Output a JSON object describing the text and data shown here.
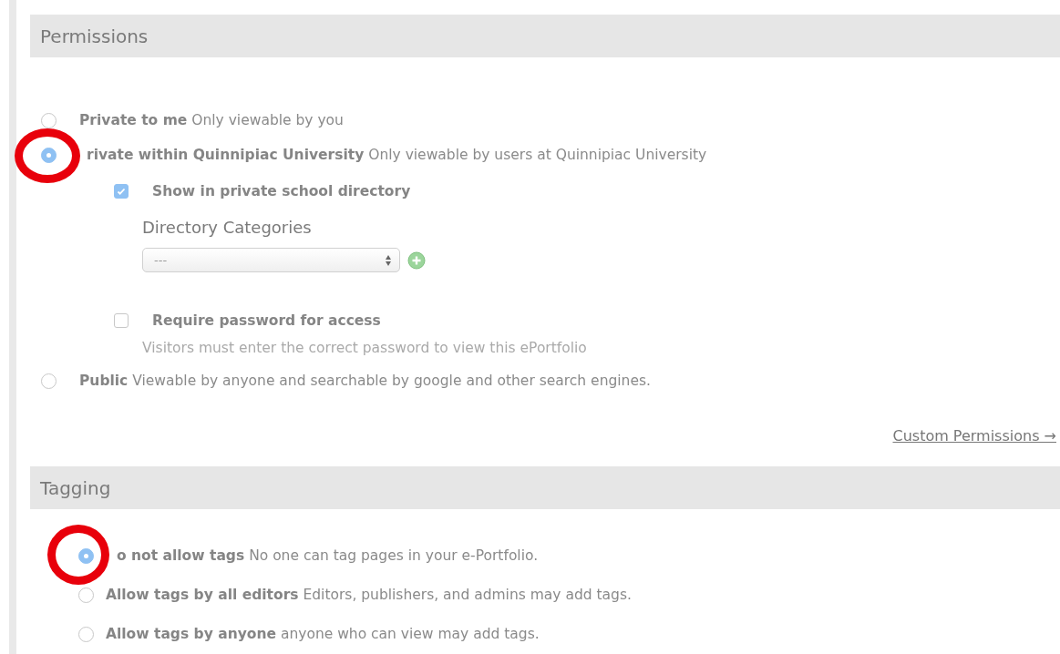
{
  "permissions": {
    "title": "Permissions",
    "options": [
      {
        "label": "Private to me",
        "description": "Only viewable by you",
        "selected": false,
        "circled": false
      },
      {
        "label": "rivate within Quinnipiac University",
        "description": "Only viewable by users at Quinnipiac University",
        "selected": true,
        "circled": true,
        "details": {
          "show_directory": {
            "label": "Show in private school directory",
            "checked": true
          },
          "categories": {
            "label": "Directory Categories",
            "value": "---"
          },
          "require_password": {
            "label": "Require password for access",
            "checked": false,
            "note": "Visitors must enter the correct password to view this ePortfolio"
          }
        }
      },
      {
        "label": "Public",
        "description": "Viewable by anyone and searchable by google and other search engines.",
        "selected": false,
        "circled": false
      }
    ],
    "custom_link": "Custom Permissions →"
  },
  "tagging": {
    "title": "Tagging",
    "options": [
      {
        "label": "o not allow tags",
        "description": "No one can tag pages in your e-Portfolio.",
        "selected": true,
        "circled": true
      },
      {
        "label": "Allow tags by all editors",
        "description": "Editors, publishers, and admins may add tags.",
        "selected": false,
        "circled": false
      },
      {
        "label": "Allow tags by anyone",
        "description": "anyone who can view may add tags.",
        "selected": false,
        "circled": false
      }
    ]
  }
}
